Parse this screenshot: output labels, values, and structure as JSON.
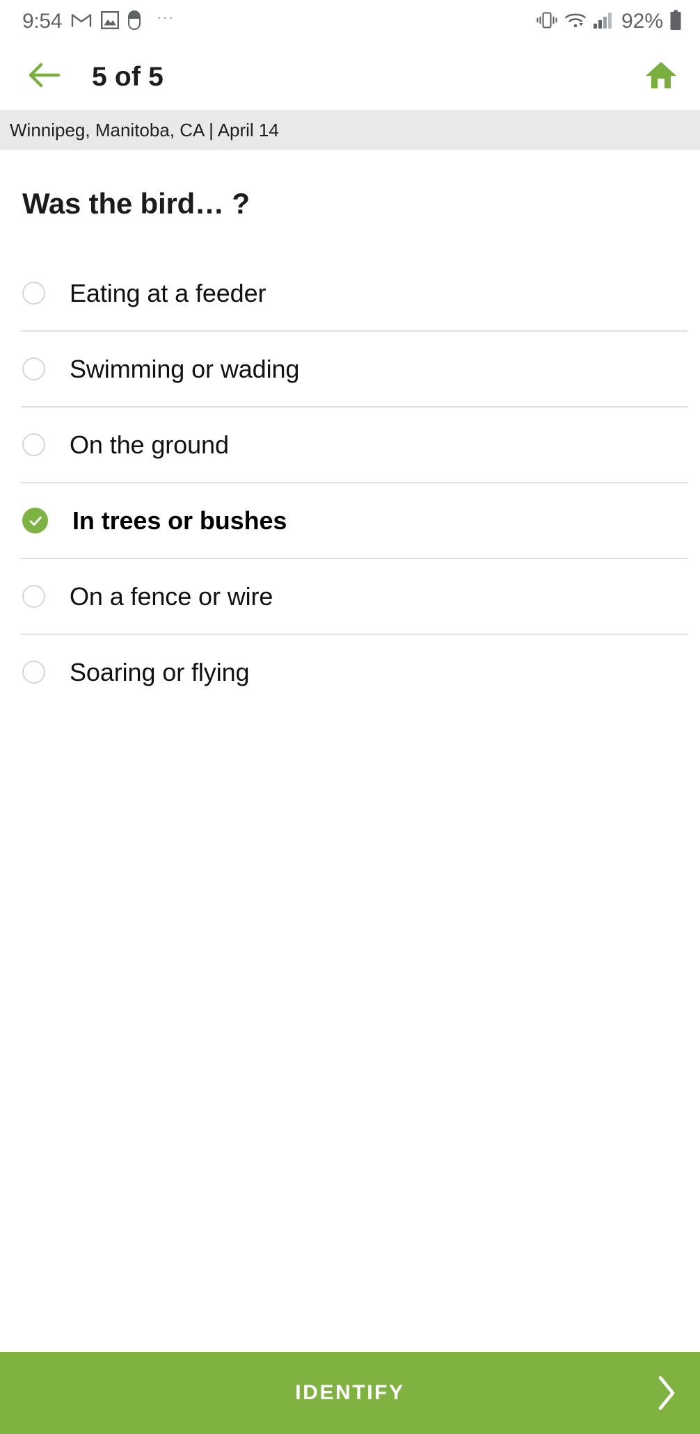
{
  "status_bar": {
    "clock": "9:54",
    "left_icons": [
      "gmail-icon",
      "photo-icon",
      "pill-icon"
    ],
    "overflow": "···",
    "right_icons": [
      "vibrate-icon",
      "wifi-icon",
      "cellular-signal-icon"
    ],
    "battery_percent": "92%",
    "battery_icon": "battery-full-icon"
  },
  "app_bar": {
    "back_icon": "arrow-left-icon",
    "title": "5 of 5",
    "home_icon": "home-icon"
  },
  "location_bar": {
    "text": "Winnipeg, Manitoba, CA | April 14"
  },
  "question": {
    "title": "Was the bird… ?"
  },
  "options": [
    {
      "label": "Eating at a feeder",
      "selected": false
    },
    {
      "label": "Swimming or wading",
      "selected": false
    },
    {
      "label": "On the ground",
      "selected": false
    },
    {
      "label": "In trees or bushes",
      "selected": true
    },
    {
      "label": "On a fence or wire",
      "selected": false
    },
    {
      "label": "Soaring or flying",
      "selected": false
    }
  ],
  "action_bar": {
    "label": "IDENTIFY",
    "chevron_icon": "chevron-right-icon"
  },
  "colors": {
    "accent_green": "#7fb241",
    "check_green": "#7cb342",
    "location_bar_bg": "#e9e9e9",
    "divider": "#e0e0e0",
    "radio_border": "#d6d6d6",
    "status_icon": "#5f6368",
    "title_text": "#1d1d1d"
  }
}
